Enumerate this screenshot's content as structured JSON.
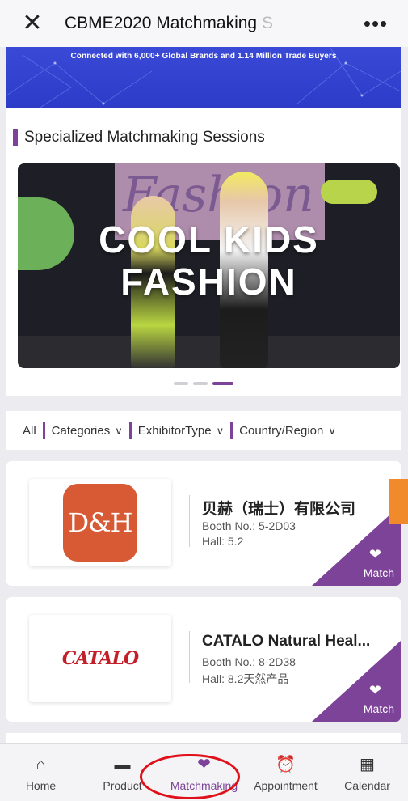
{
  "topbar": {
    "close_icon": "close-icon",
    "title": "CBME2020 Matchmaking",
    "title_fade": "S",
    "more_icon": "more-icon"
  },
  "hero": {
    "tagline": "Connected with 6,000+ Global Brands and 1.14 Million Trade Buyers",
    "color": "#3a49d6"
  },
  "sessions": {
    "title": "Specialized Matchmaking Sessions",
    "banner": {
      "headline_line1": "COOL KIDS",
      "headline_line2": "FASHION",
      "background_word": "Fashion"
    },
    "carousel": {
      "count": 3,
      "active": 3
    }
  },
  "filters": {
    "all": "All",
    "items": [
      {
        "label": "Categories",
        "icon": "chevron-down-icon"
      },
      {
        "label": "ExhibitorType",
        "icon": "chevron-down-icon"
      },
      {
        "label": "Country/Region",
        "icon": "chevron-down-icon"
      }
    ]
  },
  "exhibitors": [
    {
      "name": "贝赫（瑞士）有限公司",
      "booth": "Booth No.: 5-2D03",
      "hall": "Hall: 5.2",
      "logo_text": "D&H",
      "match_label": "Match",
      "match_icon": "handshake-icon"
    },
    {
      "name": "CATALO Natural Heal...",
      "booth": "Booth No.: 8-2D38",
      "hall": "Hall: 8.2天然产品",
      "logo_text": "CATALO",
      "match_label": "Match",
      "match_icon": "handshake-icon"
    }
  ],
  "tabbar": [
    {
      "label": "Home",
      "icon": "home-icon"
    },
    {
      "label": "Product",
      "icon": "cart-icon"
    },
    {
      "label": "Matchmaking",
      "icon": "handshake-icon",
      "active": true
    },
    {
      "label": "Appointment",
      "icon": "alarm-clock-icon"
    },
    {
      "label": "Calendar",
      "icon": "calendar-icon"
    }
  ],
  "colors": {
    "accent": "#7d4398",
    "highlight_ring": "#e0101a",
    "side_tab": "#f08a2a"
  }
}
